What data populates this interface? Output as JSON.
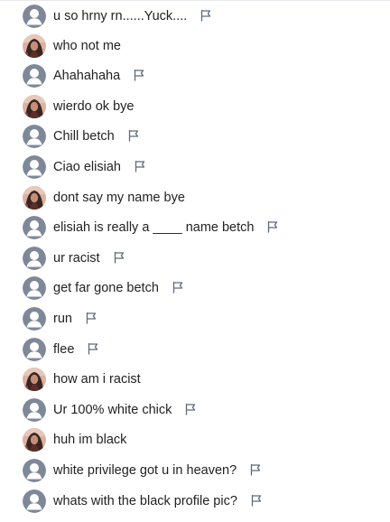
{
  "messages": [
    {
      "text": "u so hrny rn......Yuck....",
      "avatar": "default-avatar",
      "flag": true
    },
    {
      "text": "who not me",
      "avatar": "photo-avatar",
      "flag": false
    },
    {
      "text": "Ahahahaha",
      "avatar": "default-avatar",
      "flag": true
    },
    {
      "text": "wierdo ok bye",
      "avatar": "photo-avatar",
      "flag": false
    },
    {
      "text": "Chill betch",
      "avatar": "default-avatar",
      "flag": true
    },
    {
      "text": "Ciao elisiah",
      "avatar": "default-avatar",
      "flag": true
    },
    {
      "text": "dont say my name bye",
      "avatar": "photo-avatar",
      "flag": false
    },
    {
      "text": "elisiah is really a ____ name betch",
      "avatar": "default-avatar",
      "flag": true
    },
    {
      "text": "ur racist",
      "avatar": "default-avatar",
      "flag": true
    },
    {
      "text": "get far gone betch",
      "avatar": "default-avatar",
      "flag": true
    },
    {
      "text": "run",
      "avatar": "default-avatar",
      "flag": true
    },
    {
      "text": "flee",
      "avatar": "default-avatar",
      "flag": true
    },
    {
      "text": "how am i racist",
      "avatar": "photo-avatar",
      "flag": false
    },
    {
      "text": "Ur 100% white chick",
      "avatar": "default-avatar",
      "flag": true
    },
    {
      "text": "huh im black",
      "avatar": "photo-avatar",
      "flag": false
    },
    {
      "text": "white privilege got u in heaven?",
      "avatar": "default-avatar",
      "flag": true
    },
    {
      "text": "whats with the black profile pic?",
      "avatar": "default-avatar",
      "flag": true
    }
  ],
  "colors": {
    "avatar_bg": "#7f8898",
    "avatar_fg": "#ffffff",
    "flag_stroke": "#5f6b7a",
    "text": "#222222"
  }
}
